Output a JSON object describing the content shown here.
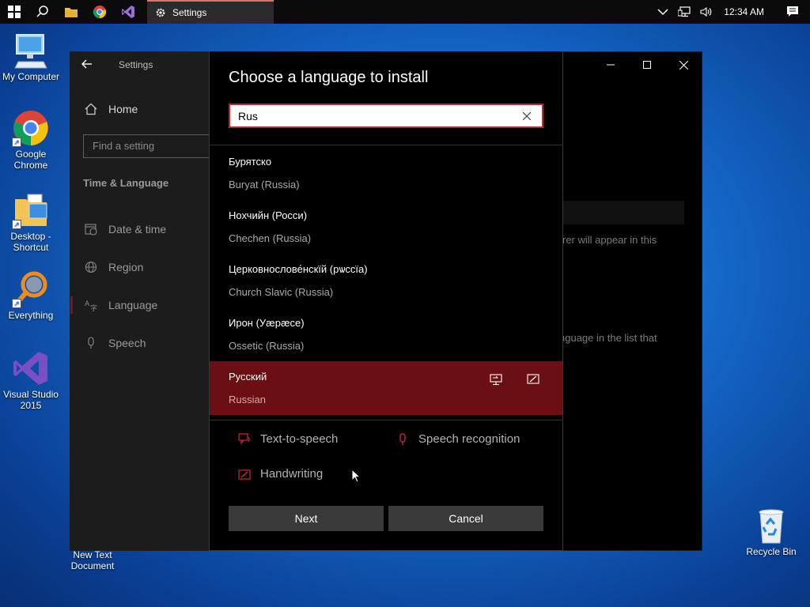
{
  "taskbar": {
    "app_label": "Settings",
    "clock": "12:34 AM"
  },
  "desktop": {
    "icons": [
      {
        "label": "My Computer"
      },
      {
        "label": "Google Chrome"
      },
      {
        "label": "Desktop - Shortcut"
      },
      {
        "label": "Everything"
      },
      {
        "label": "Visual Studio 2015"
      },
      {
        "label": "New Text Document"
      },
      {
        "label": "Recycle Bin"
      }
    ]
  },
  "window": {
    "title": "Settings",
    "sidebar": {
      "home": "Home",
      "find_placeholder": "Find a setting",
      "section": "Time & Language",
      "items": [
        {
          "label": "Date & time"
        },
        {
          "label": "Region"
        },
        {
          "label": "Language"
        },
        {
          "label": "Speech"
        }
      ]
    },
    "bg_text_1": "rer will appear in this",
    "bg_text_2": "nguage in the list that"
  },
  "dialog": {
    "title": "Choose a language to install",
    "search_value": "Rus",
    "languages": [
      {
        "native": "Бурятско",
        "english": "Buryat (Russia)"
      },
      {
        "native": "Нохчийн (Росси)",
        "english": "Chechen (Russia)"
      },
      {
        "native": "Церковнослове́нскїй (рѡссїа)",
        "english": "Church Slavic (Russia)"
      },
      {
        "native": "Ирон (Уæрæсе)",
        "english": "Ossetic (Russia)"
      },
      {
        "native": "Русский",
        "english": "Russian"
      }
    ],
    "features": {
      "tts": "Text-to-speech",
      "speech": "Speech recognition",
      "handwriting": "Handwriting"
    },
    "next_label": "Next",
    "cancel_label": "Cancel"
  },
  "colors": {
    "accent": "#c12532",
    "selected_bg": "#6b0f14"
  }
}
